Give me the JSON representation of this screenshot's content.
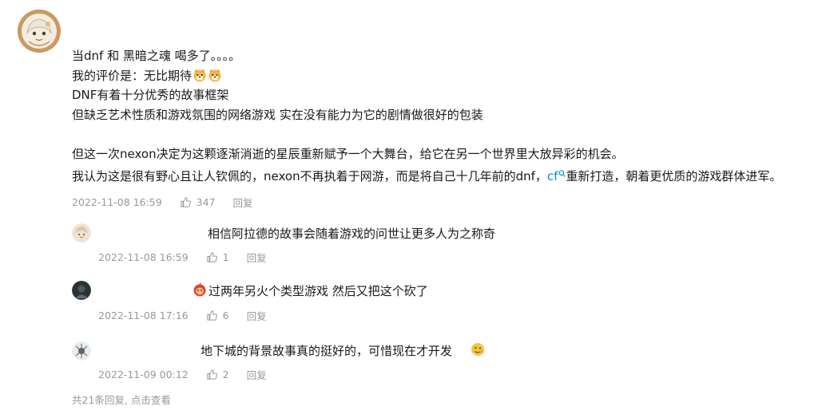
{
  "comment": {
    "lines": [
      "当dnf 和 黑暗之魂 喝多了。。。。",
      "我的评价是：无比期待",
      "DNF有着十分优秀的故事框架",
      "但缺乏艺术性质和游戏氛围的网络游戏 实在没有能力为它的剧情做很好的包装",
      "",
      "但这一次nexon决定为这颗逐渐消逝的星辰重新赋予一个大舞台，给它在另一个世界里大放异彩的机会。"
    ],
    "last_line_before": "我认为这是很有野心且让人钦佩的，nexon不再执着于网游，而是将自己十几年前的dnf，",
    "last_line_link": "cf",
    "last_line_after": "重新打造，朝着更优质的游戏群体进军。",
    "time": "2022-11-08 16:59",
    "likes": "347",
    "reply_label": "回复"
  },
  "replies": [
    {
      "text": "相信阿拉德的故事会随着游戏的问世让更多人为之称奇",
      "time": "2022-11-08 16:59",
      "likes": "1",
      "reply_label": "回复"
    },
    {
      "text": "过两年另火个类型游戏 然后又把这个砍了",
      "time": "2022-11-08 17:16",
      "likes": "6",
      "reply_label": "回复"
    },
    {
      "text": "地下城的背景故事真的挺好的，可惜现在才开发",
      "time": "2022-11-09 00:12",
      "likes": "2",
      "reply_label": "回复"
    }
  ],
  "footer": {
    "more_replies": "共21条回复, 点击查看"
  },
  "colors": {
    "text": "#18191c",
    "meta": "#9499a0",
    "link": "#008ac5"
  },
  "icons": [
    "user-avatar",
    "doge-emoji",
    "thumbs-up-icon",
    "search-icon",
    "apple-emoji",
    "wink-emoji"
  ]
}
